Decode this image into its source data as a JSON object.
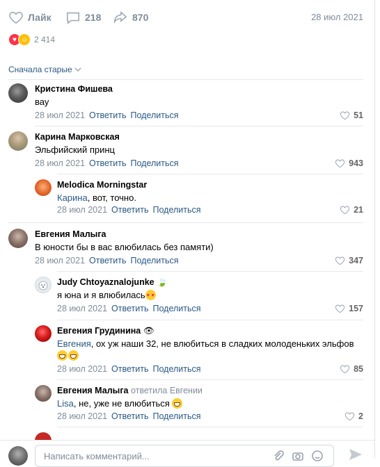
{
  "post": {
    "like_label": "Лайк",
    "comments_count": "218",
    "shares_count": "870",
    "date": "28 июл 2021",
    "reactions_count": "2 414"
  },
  "sort_label": "Сначала старые",
  "comments": [
    {
      "name": "Кристина Фишева",
      "text": "вау",
      "date": "28 июл 2021",
      "reply": "Ответить",
      "share": "Поделиться",
      "likes": "51"
    },
    {
      "name": "Карина Марковская",
      "text": "Эльфийский принц",
      "date": "28 июл 2021",
      "reply": "Ответить",
      "share": "Поделиться",
      "likes": "943"
    },
    {
      "name": "Melodica Morningstar",
      "mention": "Карина",
      "text": ", вот, точно.",
      "date": "28 июл 2021",
      "reply": "Ответить",
      "share": "Поделиться",
      "likes": "21"
    },
    {
      "name": "Евгения Малыга",
      "text": "В юности бы в вас влюбилась без памяти)",
      "date": "28 июл 2021",
      "reply": "Ответить",
      "share": "Поделиться",
      "likes": "347"
    },
    {
      "name": "Judy Chtoyaznalojunke",
      "text": "я юна и я влюбилась",
      "date": "28 июл 2021",
      "reply": "Ответить",
      "share": "Поделиться",
      "likes": "157"
    },
    {
      "name": "Евгения Грудинина",
      "mention": "Евгения",
      "text": ", ох уж наши 32, не влюбиться в сладких молоденьких эльфов",
      "date": "28 июл 2021",
      "reply": "Ответить",
      "share": "Поделиться",
      "likes": "85"
    },
    {
      "name": "Евгения Малыга",
      "name_sub": "ответила Евгении",
      "mention": "Lisa",
      "text": ", не, уже не влюбиться",
      "date": "28 июл 2021",
      "reply": "Ответить",
      "share": "Поделиться",
      "likes": "2"
    }
  ],
  "composer": {
    "placeholder": "Написать комментарий..."
  },
  "colors": {
    "link": "#2a5885",
    "muted": "#818c99",
    "accent_red": "#ff3347"
  }
}
